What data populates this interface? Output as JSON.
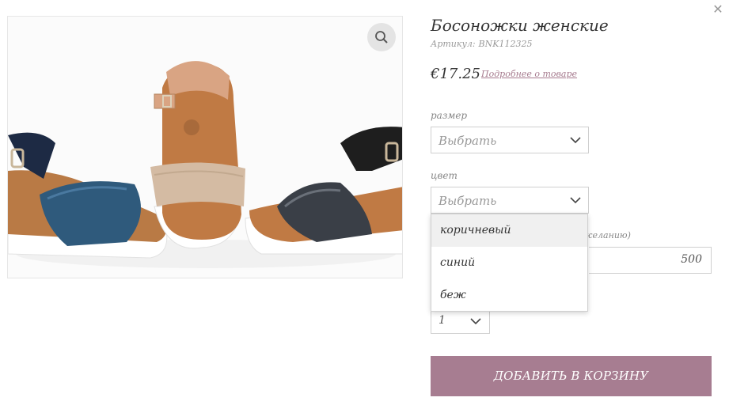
{
  "product": {
    "title": "Босоножки женские",
    "sku_label": "Артикул:",
    "sku_value": "BNK112325",
    "price": "€17.25",
    "more_link": "Подробнее о товаре",
    "image_alt": "sandals-photo"
  },
  "options": {
    "size": {
      "label": "размер",
      "placeholder": "Выбрать"
    },
    "color": {
      "label": "цвет",
      "placeholder": "Выбрать",
      "open": true,
      "items": [
        "коричневый",
        "синий",
        "беж"
      ],
      "highlighted": "коричневый"
    }
  },
  "partial_label_visible": "желанию)",
  "amount_value": "500",
  "quantity": {
    "value": "1"
  },
  "add_to_cart_label": "ДОБАВИТЬ В КОРЗИНУ",
  "colors": {
    "accent": "#a77d91",
    "link": "#a67a8e",
    "border": "#cfcfcf",
    "highlight": "#f0f0f0"
  },
  "icons": {
    "close": "close-icon",
    "zoom": "magnifier-icon",
    "chevron": "chevron-down-icon"
  }
}
